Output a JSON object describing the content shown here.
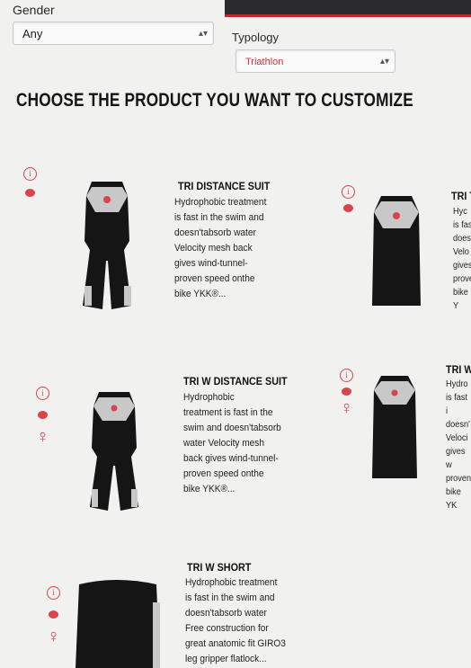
{
  "filters": {
    "gender": {
      "label": "Gender",
      "value": "Any"
    },
    "typology": {
      "label": "Typology",
      "value": "Triathlon"
    }
  },
  "page_title": "CHOOSE THE PRODUCT YOU WANT TO CUSTOMIZE",
  "icons": {
    "info_glyph": "i",
    "female_glyph": "♀"
  },
  "products": [
    {
      "title": "TRI DISTANCE SUIT",
      "description": "Hydrophobic treatment\nis fast in the swim and\ndoesn'tabsorb water\nVelocity mesh back\ngives wind-tunnel-\nproven speed onthe\nbike YKK®..."
    },
    {
      "title": "TRI T",
      "description": "Hyc\nis fas\ndoes\nVelo\ngives\nprove\nbike Y"
    },
    {
      "title": "TRI W DISTANCE SUIT",
      "description": "Hydrophobic\ntreatment is fast in the\nswim and doesn'tabsorb\nwater Velocity mesh\nback gives wind-tunnel-\nproven speed onthe\nbike YKK®..."
    },
    {
      "title": "TRI W T",
      "description": "Hydro\nis fast i\ndoesn'\nVeloci\ngives w\nproven\nbike YK"
    },
    {
      "title": "TRI W SHORT",
      "description": "Hydrophobic treatment\nis fast in the swim and\ndoesn'tabsorb water\nFree construction for\ngreat anatomic fit GIRO3\nleg gripper flatlock..."
    }
  ],
  "colors": {
    "accent": "#d9434a",
    "topbar": "#2b2b2d",
    "suit": "#151515",
    "panel": "#c8c8c8"
  }
}
